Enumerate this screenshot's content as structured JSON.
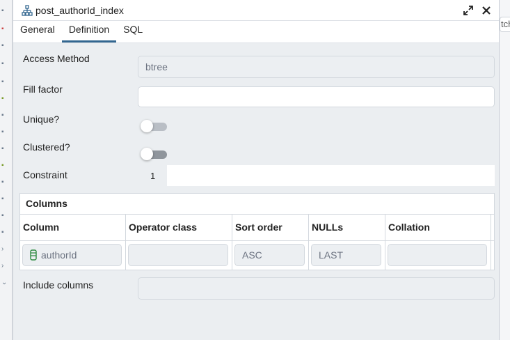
{
  "dialog": {
    "title": "post_authorId_index",
    "tabs": [
      {
        "label": "General",
        "active": false
      },
      {
        "label": "Definition",
        "active": true
      },
      {
        "label": "SQL",
        "active": false
      }
    ]
  },
  "form": {
    "access_method": {
      "label": "Access Method",
      "value": "btree"
    },
    "fill_factor": {
      "label": "Fill factor",
      "value": ""
    },
    "unique": {
      "label": "Unique?",
      "checked": false
    },
    "clustered": {
      "label": "Clustered?",
      "checked": false
    },
    "constraint": {
      "label": "Constraint",
      "line_number": "1",
      "value": ""
    },
    "columns": {
      "title": "Columns",
      "headers": [
        "Column",
        "Operator class",
        "Sort order",
        "NULLs",
        "Collation"
      ],
      "rows": [
        {
          "column": "authorId",
          "operator_class": "",
          "sort_order": "ASC",
          "nulls": "LAST",
          "collation": ""
        }
      ]
    },
    "include_columns": {
      "label": "Include columns",
      "value": ""
    }
  },
  "background": {
    "right_fragment": "tch"
  },
  "colors": {
    "accent": "#326690",
    "panel_bg": "#ebeef1",
    "column_icon": "#2b8a3e"
  }
}
